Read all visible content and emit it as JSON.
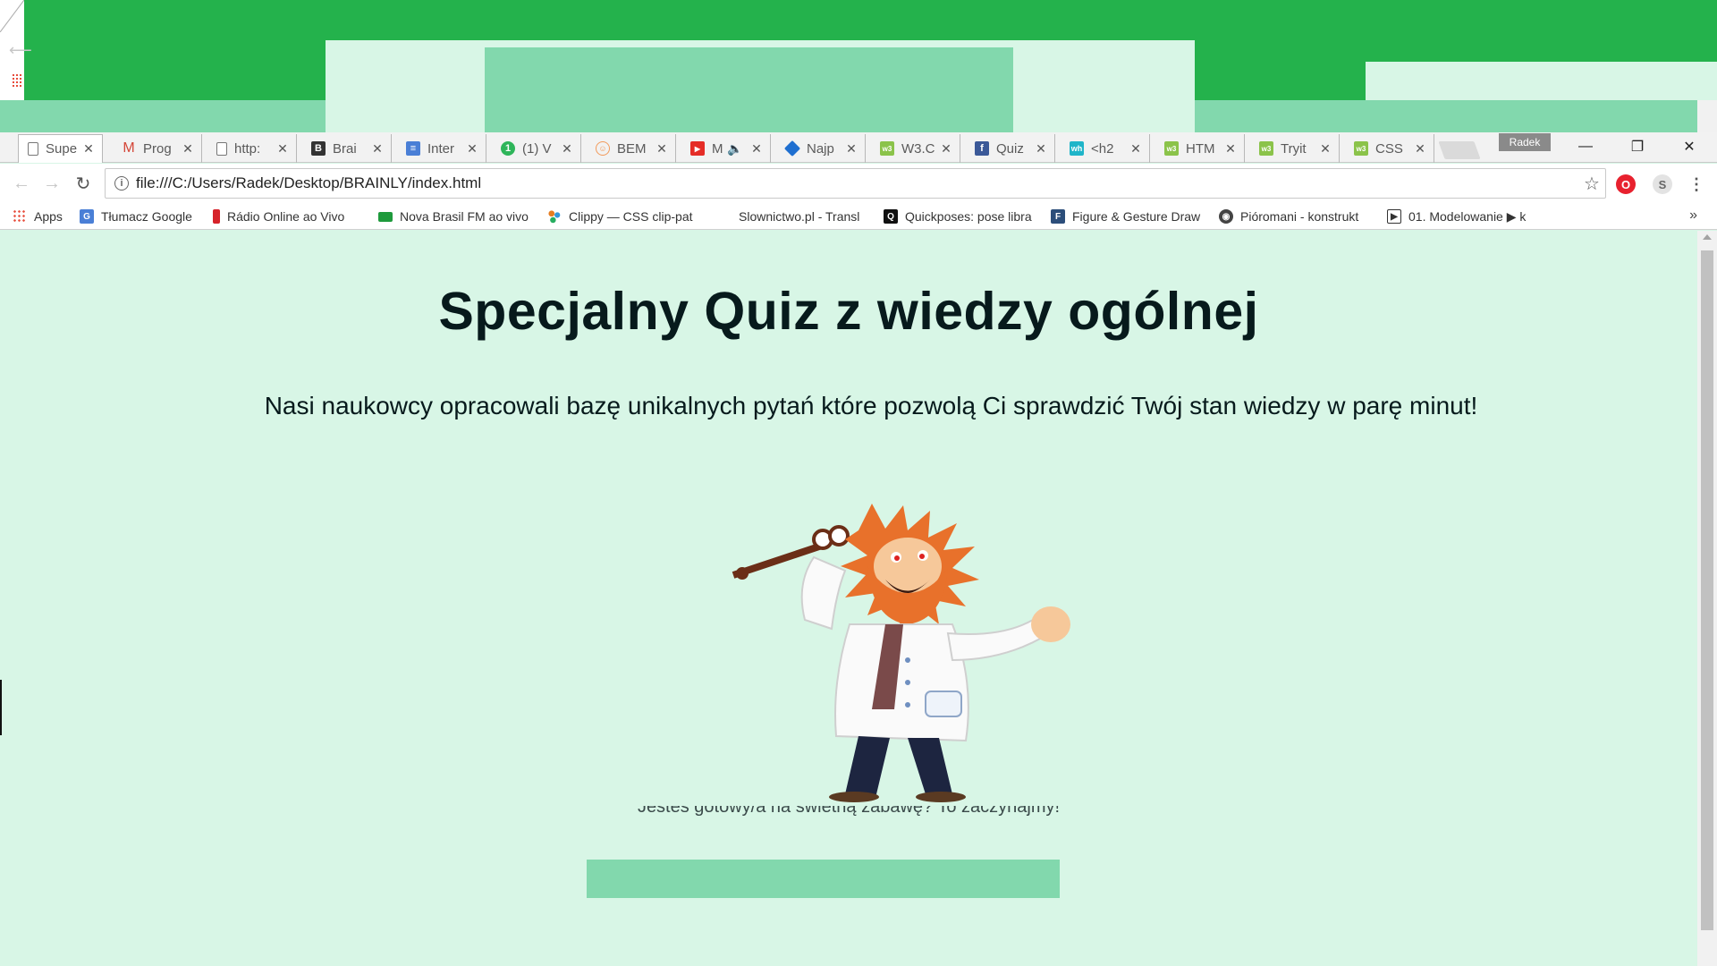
{
  "browser": {
    "tabs": [
      {
        "title": "Supe",
        "favicon": "page-icon",
        "active": true
      },
      {
        "title": "Prog",
        "favicon": "gmail-icon"
      },
      {
        "title": "http:",
        "favicon": "page-icon"
      },
      {
        "title": "Brai",
        "favicon": "brainly-icon"
      },
      {
        "title": "Inter",
        "favicon": "docs-icon"
      },
      {
        "title": "(1) V",
        "favicon": "whatsapp-icon"
      },
      {
        "title": "BEM",
        "favicon": "bem-icon"
      },
      {
        "title": "M",
        "favicon": "youtube-icon",
        "muted": true
      },
      {
        "title": "Najp",
        "favicon": "diamond-icon"
      },
      {
        "title": "W3.C",
        "favicon": "w3-icon"
      },
      {
        "title": "Quiz",
        "favicon": "facebook-icon"
      },
      {
        "title": "<h2",
        "favicon": "wh-icon"
      },
      {
        "title": "HTM",
        "favicon": "w3-icon"
      },
      {
        "title": "Tryit",
        "favicon": "w3-icon"
      },
      {
        "title": "CSS",
        "favicon": "w3-icon"
      }
    ],
    "profile_name": "Radek",
    "window_controls": {
      "minimize": "—",
      "restore": "❐",
      "close": "✕"
    },
    "address_bar": {
      "url": "file:///C:/Users/Radek/Desktop/BRAINLY/index.html"
    },
    "bookmarks": [
      {
        "label": "Apps",
        "icon": "apps-grid-icon"
      },
      {
        "label": "Tłumacz Google",
        "icon": "google-translate-icon"
      },
      {
        "label": "Rádio Online ao Vivo",
        "icon": "radio-icon"
      },
      {
        "label": "Nova Brasil FM ao vivo",
        "icon": "brazil-flag-icon"
      },
      {
        "label": "Clippy — CSS clip-pat",
        "icon": "clippy-icon"
      },
      {
        "label": "Slownictwo.pl - Transl",
        "icon": "none"
      },
      {
        "label": "Quickposes: pose libra",
        "icon": "quickposes-icon"
      },
      {
        "label": "Figure & Gesture Draw",
        "icon": "figure-icon"
      },
      {
        "label": "Pióromani - konstrukt",
        "icon": "pioromani-icon"
      },
      {
        "label": "01. Modelowanie ▶ k",
        "icon": "video-icon"
      }
    ],
    "bookmarks_more": "»"
  },
  "page": {
    "title": "Specjalny Quiz z wiedzy ogólnej",
    "subtitle": "Nasi naukowcy opracowali bazę unikalnych pytań które pozwolą Ci sprawdzić Twój stan wiedzy w parę minut!",
    "partially_hidden_text": "Jesteś gotowy/a na świetną zabawę? To zaczynajmy!",
    "start_button_label": ""
  },
  "colors": {
    "page_background": "#d8f6e6",
    "accent_green": "#24b24c",
    "button_green": "#82d8ad",
    "heading_text": "#071a1c"
  }
}
